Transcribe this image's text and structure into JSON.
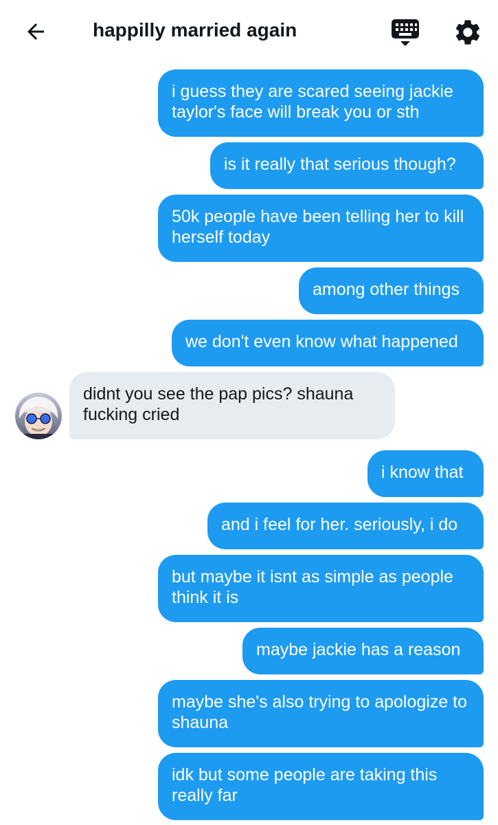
{
  "header": {
    "title": "happilly married again",
    "back_icon": "arrow-left-icon",
    "keyboard_icon": "keyboard-icon",
    "settings_icon": "gear-icon"
  },
  "colors": {
    "outgoing_bubble": "#1d9bf0",
    "incoming_bubble": "#e6ecf0",
    "text_dark": "#14171a"
  },
  "messages": [
    {
      "direction": "out",
      "text": "i guess they are scared seeing jackie taylor's face will break you or sth"
    },
    {
      "direction": "out",
      "text": "is it really that serious though?"
    },
    {
      "direction": "out",
      "text": "50k people have been telling her to kill herself today"
    },
    {
      "direction": "out",
      "text": "among other things"
    },
    {
      "direction": "out",
      "text": "we don't even know what happened"
    },
    {
      "direction": "in",
      "text": "didnt you see the pap pics? shauna fucking cried"
    },
    {
      "direction": "out",
      "text": "i know that"
    },
    {
      "direction": "out",
      "text": "and i feel for her. seriously, i do"
    },
    {
      "direction": "out",
      "text": "but maybe it isnt as simple as people think it is"
    },
    {
      "direction": "out",
      "text": "maybe jackie has a reason"
    },
    {
      "direction": "out",
      "text": "maybe she's also trying to apologize to shauna"
    },
    {
      "direction": "out",
      "text": "idk but some people are taking this really far"
    }
  ]
}
